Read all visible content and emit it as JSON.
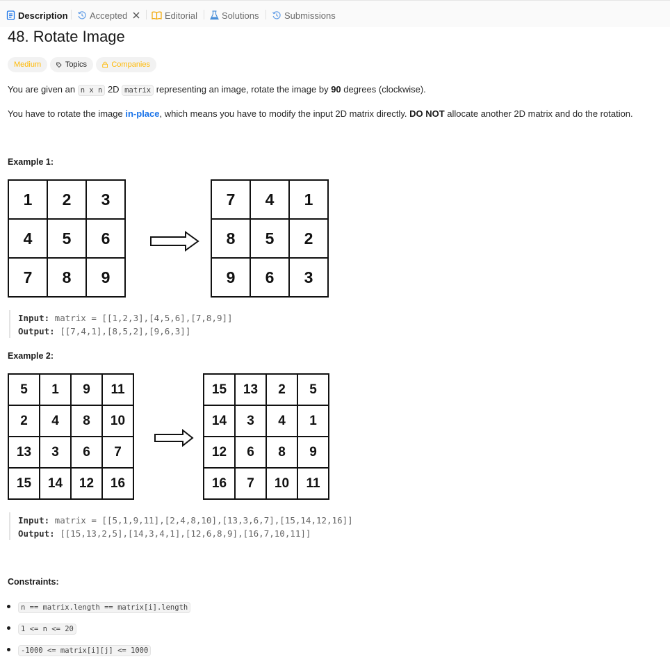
{
  "tabs": {
    "description": "Description",
    "accepted": "Accepted",
    "editorial": "Editorial",
    "solutions": "Solutions",
    "submissions": "Submissions"
  },
  "problem": {
    "title": "48. Rotate Image",
    "tags": {
      "difficulty": "Medium",
      "topics": "Topics",
      "companies": "Companies"
    }
  },
  "colors": {
    "difficulty": "#ffb800",
    "link": "#1a73e8",
    "accepted_icon": "#6ba3e8"
  },
  "description": {
    "p1": {
      "t1": "You are given an ",
      "c1": "n x n",
      "t2": " 2D ",
      "c2": "matrix",
      "t3": " representing an image, rotate the image by ",
      "b1": "90",
      "t4": " degrees (clockwise)."
    },
    "p2": {
      "t1": "You have to rotate the image ",
      "link": "in-place",
      "t2": ", which means you have to modify the input 2D matrix directly. ",
      "b1": "DO NOT",
      "t3": " allocate another 2D matrix and do the rotation."
    }
  },
  "example1": {
    "heading": "Example 1:",
    "before": [
      [
        "1",
        "2",
        "3"
      ],
      [
        "4",
        "5",
        "6"
      ],
      [
        "7",
        "8",
        "9"
      ]
    ],
    "after": [
      [
        "7",
        "4",
        "1"
      ],
      [
        "8",
        "5",
        "2"
      ],
      [
        "9",
        "6",
        "3"
      ]
    ],
    "input_label": "Input:",
    "input_value": " matrix = [[1,2,3],[4,5,6],[7,8,9]]",
    "output_label": "Output:",
    "output_value": " [[7,4,1],[8,5,2],[9,6,3]]"
  },
  "example2": {
    "heading": "Example 2:",
    "before": [
      [
        "5",
        "1",
        "9",
        "11"
      ],
      [
        "2",
        "4",
        "8",
        "10"
      ],
      [
        "13",
        "3",
        "6",
        "7"
      ],
      [
        "15",
        "14",
        "12",
        "16"
      ]
    ],
    "after": [
      [
        "15",
        "13",
        "2",
        "5"
      ],
      [
        "14",
        "3",
        "4",
        "1"
      ],
      [
        "12",
        "6",
        "8",
        "9"
      ],
      [
        "16",
        "7",
        "10",
        "11"
      ]
    ],
    "input_label": "Input:",
    "input_value": " matrix = [[5,1,9,11],[2,4,8,10],[13,3,6,7],[15,14,12,16]]",
    "output_label": "Output:",
    "output_value": " [[15,13,2,5],[14,3,4,1],[12,6,8,9],[16,7,10,11]]"
  },
  "constraints": {
    "heading": "Constraints:",
    "items": [
      "n == matrix.length == matrix[i].length",
      "1 <= n <= 20",
      "-1000 <= matrix[i][j] <= 1000"
    ]
  },
  "icons": {
    "description": "document-icon",
    "accepted": "history-icon",
    "close": "close-icon",
    "editorial": "book-icon",
    "solutions": "flask-icon",
    "submissions": "history-icon",
    "topics": "tag-icon",
    "companies": "lock-icon",
    "arrow": "right-arrow-icon"
  }
}
